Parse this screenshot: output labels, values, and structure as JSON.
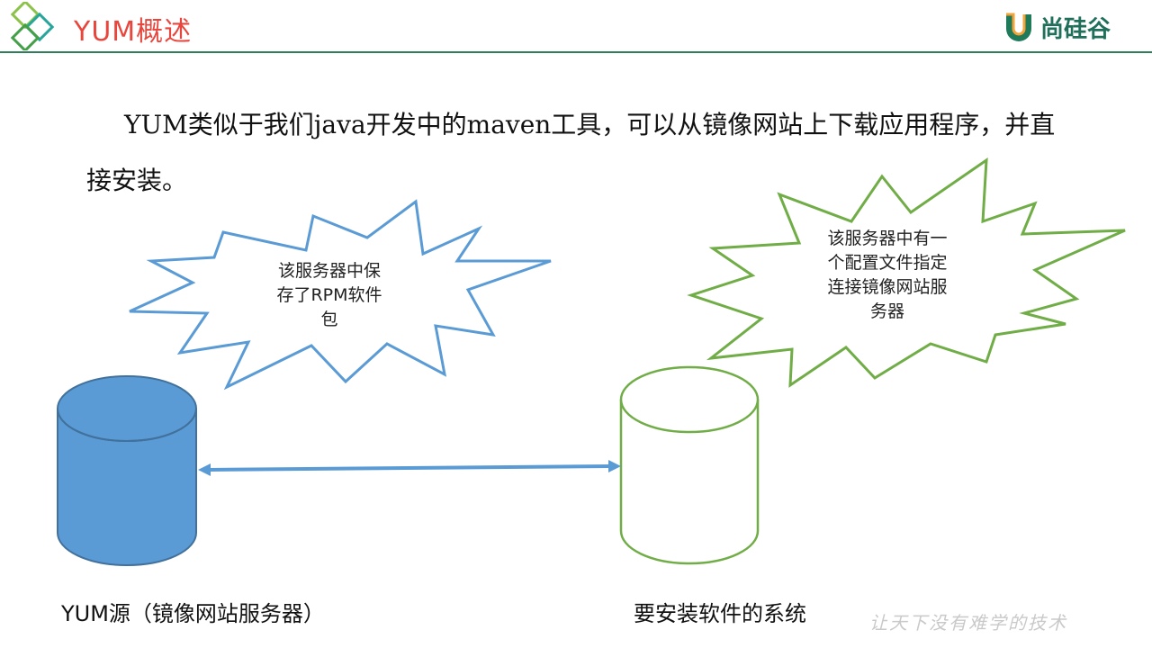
{
  "header": {
    "title": "YUM概述",
    "brand": "尚硅谷"
  },
  "intro": {
    "text": "YUM类似于我们java开发中的maven工具，可以从镜像网站上下载应用程序，并直接安装。"
  },
  "diagram": {
    "server_note_lines": [
      "该服务器中保",
      "存了RPM软件",
      "包"
    ],
    "client_note_lines": [
      "该服务器中有一",
      "个配置文件指定",
      "连接镜像网站服",
      "务器"
    ],
    "server_caption": "YUM源（镜像网站服务器）",
    "client_caption": "要安装软件的系统",
    "colors": {
      "server": "#5b9bd5",
      "server_stroke": "#41719c",
      "client": "#70ad47",
      "connector": "#5b9bd5"
    }
  },
  "watermark": "让天下没有难学的技术"
}
